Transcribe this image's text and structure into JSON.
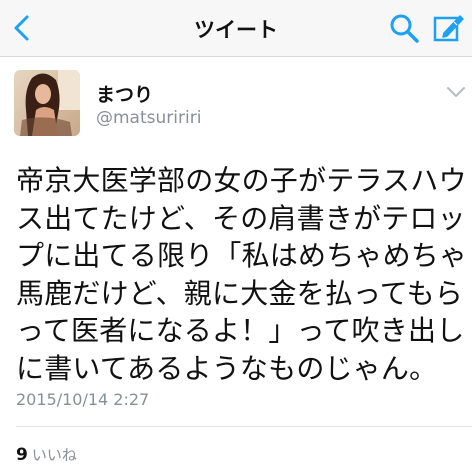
{
  "nav": {
    "title": "ツイート",
    "back_icon": "chevron-left-icon",
    "search_icon": "search-icon",
    "compose_icon": "compose-icon",
    "accent_color": "#1da1f2"
  },
  "tweet": {
    "display_name": "まつり",
    "username": "@matsuririri",
    "text_lines": [
      "帝京大医学部の女の子がテラスハウ",
      "ス出てたけど、その肩書きがテロッ",
      "プに出てる限り「私はめちゃめちゃ",
      "馬鹿だけど、親に大金を払ってもら",
      "って医者になるよ！」って吹き出し",
      "に書いてあるようなものじゃん。"
    ],
    "timestamp": "2015/10/14 2:27",
    "like_count": "9",
    "like_label": "いいね"
  }
}
